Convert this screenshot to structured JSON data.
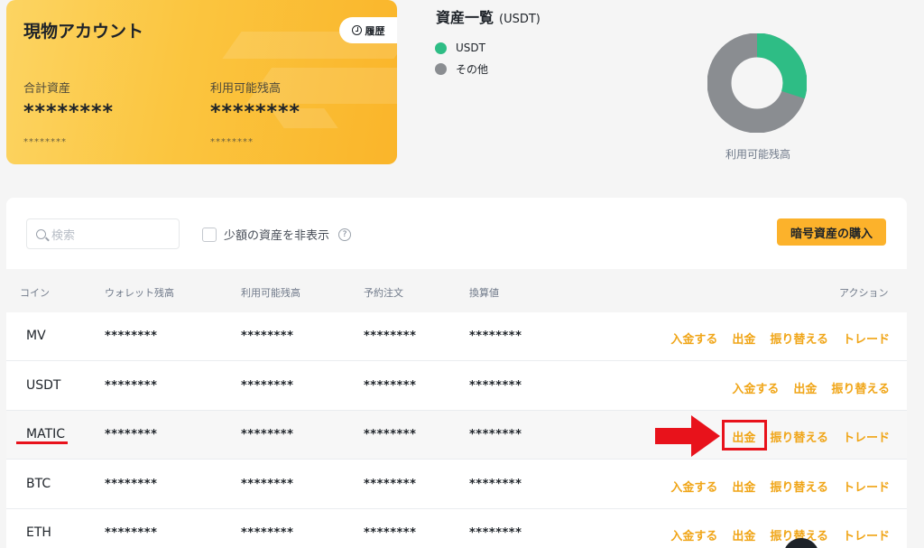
{
  "account": {
    "title": "現物アカウント",
    "history_label": "履歴",
    "total_label": "合計資産",
    "total_value": "********",
    "total_sub": "********",
    "available_label": "利用可能残高",
    "available_value": "********",
    "available_sub": "********"
  },
  "overview": {
    "title": "資産一覧",
    "unit": "(USDT)",
    "legend": [
      {
        "label": "USDT",
        "color": "#2ebd85"
      },
      {
        "label": "その他",
        "color": "#8a8d91"
      }
    ],
    "donut_label": "利用可能残高",
    "usdt_share": 0.3
  },
  "toolbar": {
    "search_placeholder": "検索",
    "hide_small_label": "少額の資産を非表示",
    "help_glyph": "?",
    "buy_label": "暗号資産の購入"
  },
  "table": {
    "headers": {
      "coin": "コイン",
      "wallet": "ウォレット残高",
      "available": "利用可能残高",
      "order": "予約注文",
      "converted": "換算値",
      "action": "アクション"
    },
    "rows": [
      {
        "coin": "MV",
        "wallet": "********",
        "available": "********",
        "order": "********",
        "converted": "********",
        "actions": [
          "入金する",
          "出金",
          "振り替える",
          "トレード"
        ]
      },
      {
        "coin": "USDT",
        "wallet": "********",
        "available": "********",
        "order": "********",
        "converted": "********",
        "actions": [
          "入金する",
          "出金",
          "振り替える"
        ]
      },
      {
        "coin": "MATIC",
        "wallet": "********",
        "available": "********",
        "order": "********",
        "converted": "********",
        "actions": [
          "出金",
          "振り替える",
          "トレード"
        ]
      },
      {
        "coin": "BTC",
        "wallet": "********",
        "available": "********",
        "order": "********",
        "converted": "********",
        "actions": [
          "入金する",
          "出金",
          "振り替える",
          "トレード"
        ]
      },
      {
        "coin": "ETH",
        "wallet": "********",
        "available": "********",
        "order": "********",
        "converted": "********",
        "actions": [
          "入金する",
          "出金",
          "振り替える",
          "トレード"
        ]
      }
    ]
  },
  "colors": {
    "accent": "#f0a517",
    "button": "#fcb22b",
    "annotation": "#e8121b"
  }
}
